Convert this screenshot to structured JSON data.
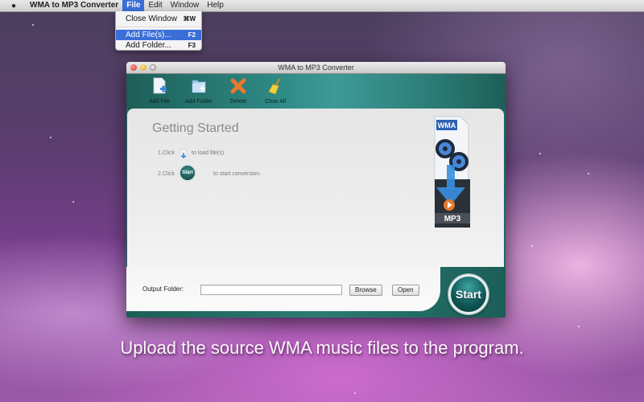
{
  "menubar": {
    "app_name": "WMA to MP3 Converter",
    "items": [
      {
        "label": "File",
        "active": true
      },
      {
        "label": "Edit"
      },
      {
        "label": "Window"
      },
      {
        "label": "Help"
      }
    ]
  },
  "file_menu": {
    "items": [
      {
        "label": "Close Window",
        "shortcut": "⌘W"
      },
      {
        "label": "Add File(s)...",
        "shortcut": "F2",
        "highlighted": true
      },
      {
        "label": "Add Folder...",
        "shortcut": "F3"
      }
    ]
  },
  "window": {
    "title": "WMA to MP3 Converter",
    "toolbar": {
      "add_file": "Add File",
      "add_folder": "Add Folder",
      "delete": "Delete",
      "clear_all": "Clear All"
    },
    "getting_started": {
      "title": "Getting Started",
      "step1_prefix": "1.Click",
      "step1_suffix": "to load file(s).",
      "step2_prefix": "2.Click",
      "step2_icon_label": "Start",
      "step2_suffix": "to start conversion."
    },
    "graphic": {
      "source_label": "WMA",
      "target_label": "MP3"
    },
    "footer": {
      "output_folder_label": "Output Folder:",
      "output_folder_value": "",
      "browse_label": "Browse",
      "open_label": "Open",
      "start_label": "Start"
    }
  },
  "caption": "Upload the source WMA music files to the program.",
  "colors": {
    "teal": "#1f6a63",
    "menu_highlight": "#3b6fd8"
  }
}
